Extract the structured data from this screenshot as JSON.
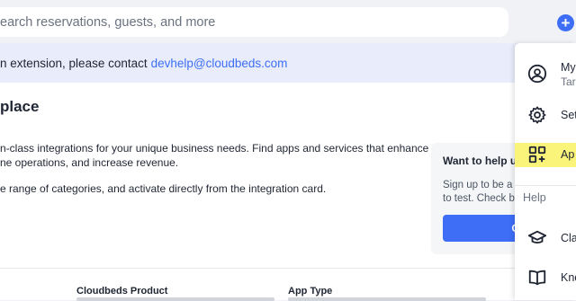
{
  "search": {
    "placeholder": "Search reservations, guests, and more",
    "visible_text": "earch reservations, guests, and more"
  },
  "header": {
    "add_icon": "plus-icon"
  },
  "banner": {
    "text": "n extension, please contact",
    "email": "devhelp@cloudbeds.com"
  },
  "page": {
    "title": "place",
    "description_lines": [
      "n-class integrations for your unique business needs. Find apps and services that enhance",
      "ne operations, and increase revenue.",
      "e range of categories, and activate directly from the integration card."
    ]
  },
  "card": {
    "title": "Want to help us",
    "text_lines": [
      "Sign up to be a t",
      "to test. Check bo"
    ],
    "button_label": "OP"
  },
  "filters": {
    "product_label": "Cloudbeds Product",
    "type_label": "App Type"
  },
  "menu": {
    "profile": {
      "label": "My",
      "sub": "Tar",
      "icon": "user-circle-icon"
    },
    "settings": {
      "label": "Set",
      "icon": "gear-icon"
    },
    "apps": {
      "label": "Ap",
      "icon": "apps-grid-add-icon"
    },
    "help_header": "Help",
    "academy": {
      "label": "Cla",
      "icon": "graduation-cap-icon"
    },
    "knowledge": {
      "label": "Kno",
      "icon": "book-icon"
    }
  },
  "colors": {
    "accent": "#3d6ef5",
    "highlight": "#fbf47a",
    "banner_bg": "#e9edfb"
  }
}
